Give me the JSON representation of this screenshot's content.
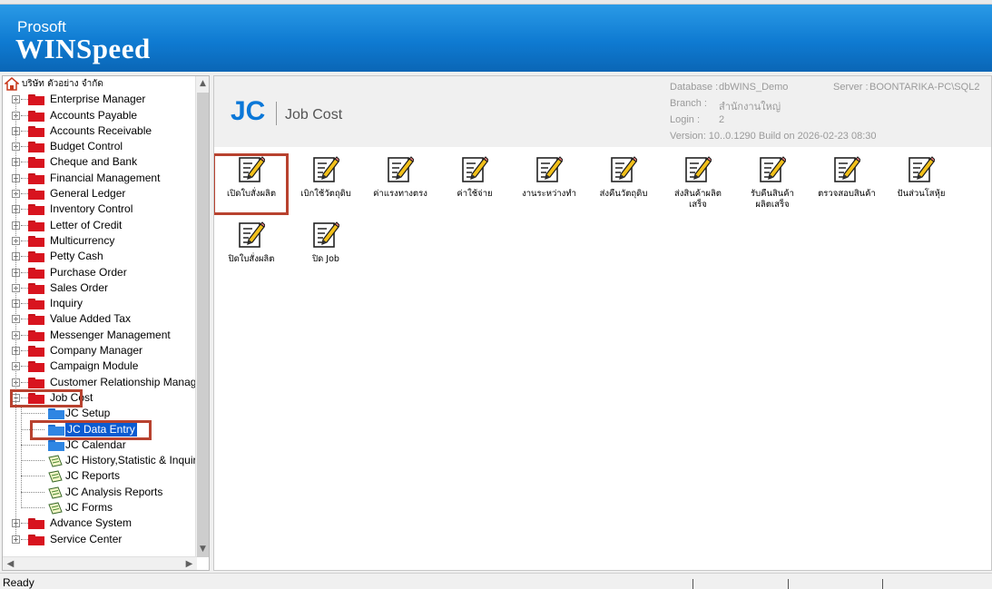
{
  "brand": {
    "small": "Prosoft",
    "big": "WINSpeed"
  },
  "tree": {
    "root": "บริษัท ตัวอย่าง จำกัด",
    "modules": [
      "Enterprise Manager",
      "Accounts Payable",
      "Accounts Receivable",
      "Budget Control",
      "Cheque and Bank",
      "Financial Management",
      "General Ledger",
      "Inventory Control",
      "Letter of Credit",
      "Multicurrency",
      "Petty Cash",
      "Purchase Order",
      "Sales Order",
      "Inquiry",
      "Value Added Tax",
      "Messenger Management",
      "Company Manager",
      "Campaign Module",
      "Customer Relationship Manage"
    ],
    "job_cost": "Job Cost",
    "job_cost_children": [
      "JC Setup",
      "JC Data Entry",
      "JC Calendar",
      "JC History,Statistic & Inquiri",
      "JC Reports",
      "JC Analysis Reports",
      "JC Forms"
    ],
    "after": [
      "Advance System",
      "Service Center"
    ]
  },
  "header": {
    "logo": "JC",
    "title": "Job Cost",
    "database_label": "Database :",
    "database_value": "dbWINS_Demo",
    "server_label": "Server :",
    "server_value": "BOONTARIKA-PC\\SQL2",
    "branch_label": "Branch :",
    "branch_value": "สำนักงานใหญ่",
    "login_label": "Login :",
    "login_value": "2",
    "version": "Version: 10..0.1290  Build on 2026-02-23  08:30"
  },
  "icons": [
    {
      "label": "เปิดใบสั่งผลิต",
      "label2": ""
    },
    {
      "label": "เบิกใช้วัตถุดิบ",
      "label2": ""
    },
    {
      "label": "ค่าแรงทางตรง",
      "label2": ""
    },
    {
      "label": "ค่าใช้จ่าย",
      "label2": ""
    },
    {
      "label": "งานระหว่างทำ",
      "label2": ""
    },
    {
      "label": "ส่งคืนวัตถุดิบ",
      "label2": ""
    },
    {
      "label": "ส่งสินค้าผลิต",
      "label2": "เสร็จ"
    },
    {
      "label": "รับคืนสินค้า",
      "label2": "ผลิตเสร็จ"
    },
    {
      "label": "ตรวจสอบสินค้า",
      "label2": ""
    },
    {
      "label": "ปันส่วนโสหุ้ย",
      "label2": ""
    },
    {
      "label": "ปิดใบสั่งผลิต",
      "label2": ""
    },
    {
      "label": "ปิด Job",
      "label2": ""
    }
  ],
  "status": {
    "text": "Ready"
  },
  "colors": {
    "banner": "#0f7bd2",
    "accent_red": "#b8422f",
    "selection": "#0a5bd1",
    "jc_blue": "#0a77d8"
  }
}
